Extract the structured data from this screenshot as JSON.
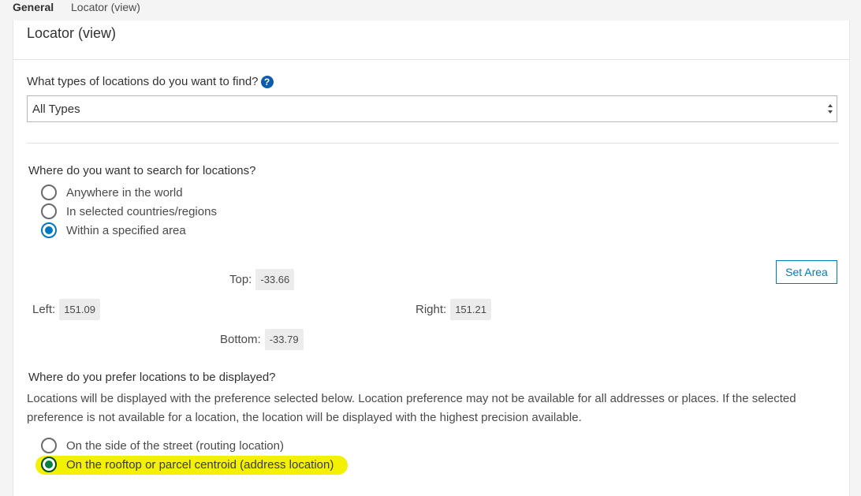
{
  "tabs": [
    {
      "label": "General"
    },
    {
      "label": "Locator (view)"
    }
  ],
  "panel": {
    "title": "Locator (view)"
  },
  "types": {
    "question": "What types of locations do you want to find?",
    "help_icon": "?",
    "selected": "All Types"
  },
  "search": {
    "question": "Where do you want to search for locations?",
    "options": [
      {
        "label": "Anywhere in the world",
        "checked": false
      },
      {
        "label": "In selected countries/regions",
        "checked": false
      },
      {
        "label": "Within a specified area",
        "checked": true
      }
    ]
  },
  "area": {
    "top_label": "Top:",
    "top_value": "-33.66",
    "left_label": "Left:",
    "left_value": "151.09",
    "right_label": "Right:",
    "right_value": "151.21",
    "bottom_label": "Bottom:",
    "bottom_value": "-33.79",
    "set_area_label": "Set Area"
  },
  "display": {
    "question": "Where do you prefer locations to be displayed?",
    "description": "Locations will be displayed with the preference selected below. Location preference may not be available for all addresses or places. If the selected preference is not available for a location, the location will be displayed with the highest precision available.",
    "options": [
      {
        "label": "On the side of the street (routing location)",
        "checked": false
      },
      {
        "label": "On the rooftop or parcel centroid (address location)",
        "checked": true
      }
    ]
  },
  "colors": {
    "accent": "#0079c1",
    "highlight": "#f4f100",
    "help_icon": "#0b5cad"
  }
}
